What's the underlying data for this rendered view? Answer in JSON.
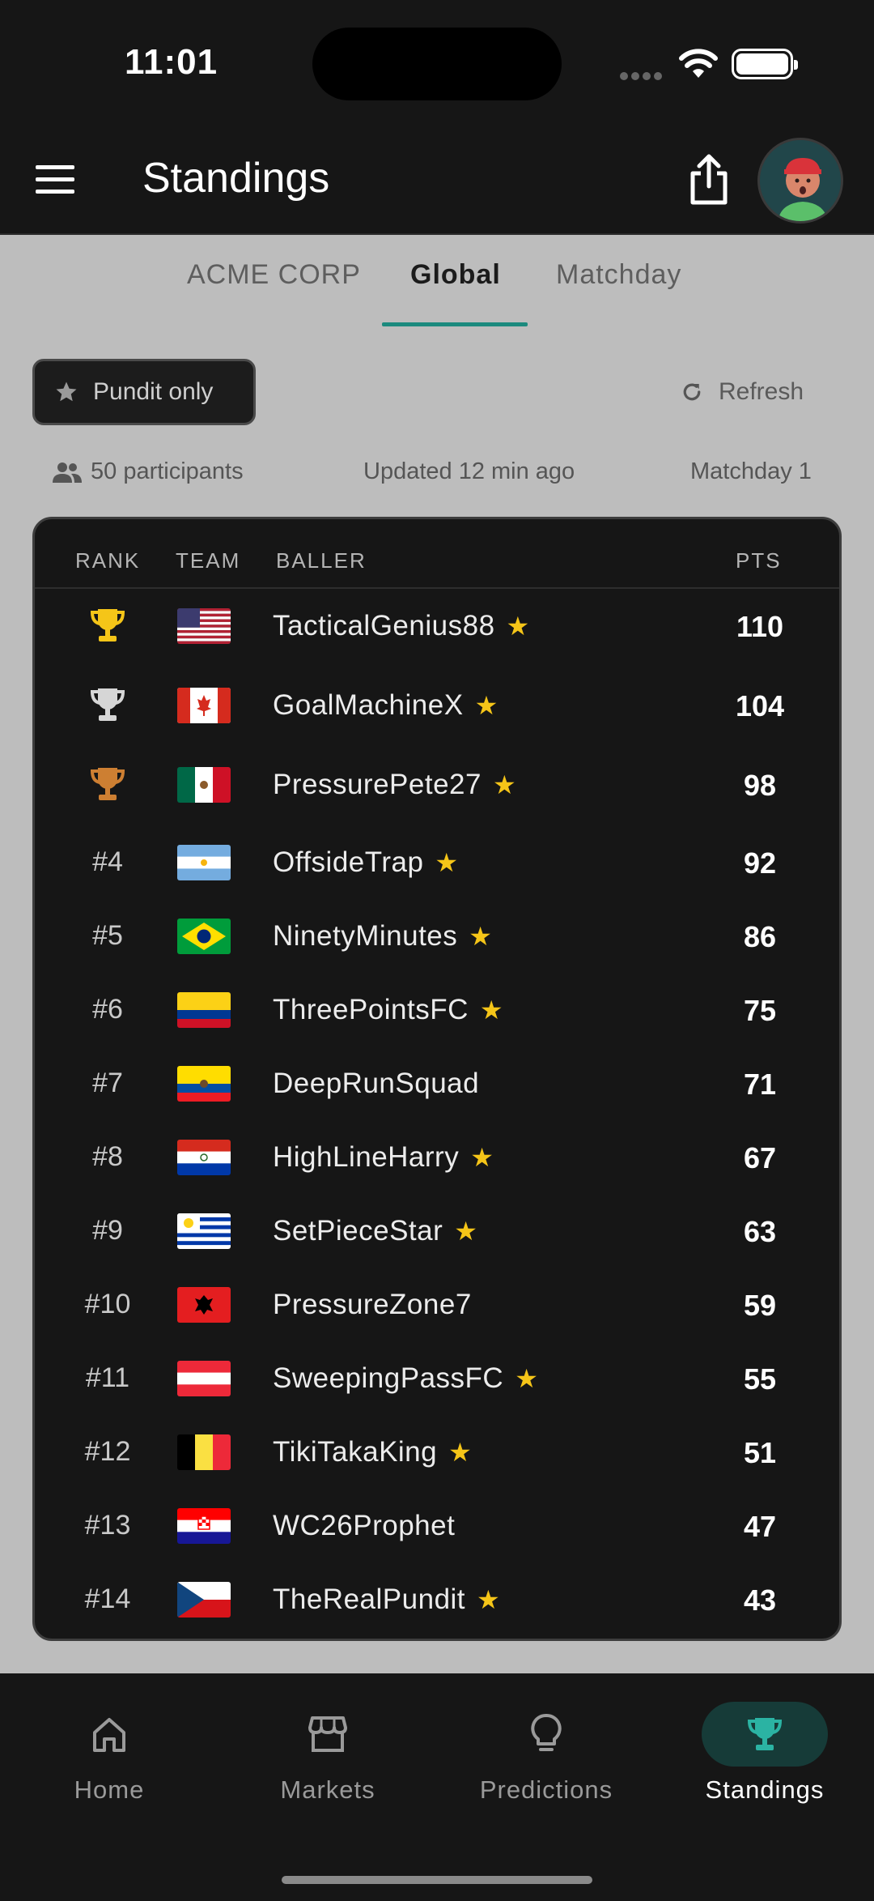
{
  "status_bar": {
    "time": "11:01"
  },
  "header": {
    "title": "Standings"
  },
  "tabs": [
    {
      "label": "ACME CORP"
    },
    {
      "label": "Global"
    },
    {
      "label": "Matchday"
    }
  ],
  "filters": {
    "pundit_label": "Pundit only",
    "refresh_label": "Refresh"
  },
  "meta": {
    "participants": "50 participants",
    "updated": "Updated 12 min ago",
    "matchday": "Matchday 1"
  },
  "table": {
    "headers": {
      "rank": "RANK",
      "team": "TEAM",
      "baller": "BALLER",
      "pts": "PTS"
    },
    "rows": [
      {
        "rank": "",
        "trophy": "gold",
        "flag": "us",
        "name": "TacticalGenius88",
        "pundit": true,
        "pts": "110"
      },
      {
        "rank": "",
        "trophy": "silver",
        "flag": "ca",
        "name": "GoalMachineX",
        "pundit": true,
        "pts": "104"
      },
      {
        "rank": "",
        "trophy": "bronze",
        "flag": "mx",
        "name": "PressurePete27",
        "pundit": true,
        "pts": "98"
      },
      {
        "rank": "#4",
        "flag": "ar",
        "name": "OffsideTrap",
        "pundit": true,
        "pts": "92"
      },
      {
        "rank": "#5",
        "flag": "br",
        "name": "NinetyMinutes",
        "pundit": true,
        "pts": "86"
      },
      {
        "rank": "#6",
        "flag": "co",
        "name": "ThreePointsFC",
        "pundit": true,
        "pts": "75"
      },
      {
        "rank": "#7",
        "flag": "ec",
        "name": "DeepRunSquad",
        "pundit": false,
        "pts": "71"
      },
      {
        "rank": "#8",
        "flag": "py",
        "name": "HighLineHarry",
        "pundit": true,
        "pts": "67"
      },
      {
        "rank": "#9",
        "flag": "uy",
        "name": "SetPieceStar",
        "pundit": true,
        "pts": "63"
      },
      {
        "rank": "#10",
        "flag": "al",
        "name": "PressureZone7",
        "pundit": false,
        "pts": "59"
      },
      {
        "rank": "#11",
        "flag": "at",
        "name": "SweepingPassFC",
        "pundit": true,
        "pts": "55"
      },
      {
        "rank": "#12",
        "flag": "be",
        "name": "TikiTakaKing",
        "pundit": true,
        "pts": "51"
      },
      {
        "rank": "#13",
        "flag": "hr",
        "name": "WC26Prophet",
        "pundit": false,
        "pts": "47"
      },
      {
        "rank": "#14",
        "flag": "cz",
        "name": "TheRealPundit",
        "pundit": true,
        "pts": "43"
      }
    ]
  },
  "bottom_nav": [
    {
      "label": "Home",
      "icon": "home-icon"
    },
    {
      "label": "Markets",
      "icon": "store-icon"
    },
    {
      "label": "Predictions",
      "icon": "lightbulb-icon"
    },
    {
      "label": "Standings",
      "icon": "trophy-icon"
    }
  ],
  "colors": {
    "accent": "#1c8a7e",
    "star": "#f5c518",
    "gold": "#f5c518",
    "silver": "#d6d6d6",
    "bronze": "#cd7f32"
  }
}
